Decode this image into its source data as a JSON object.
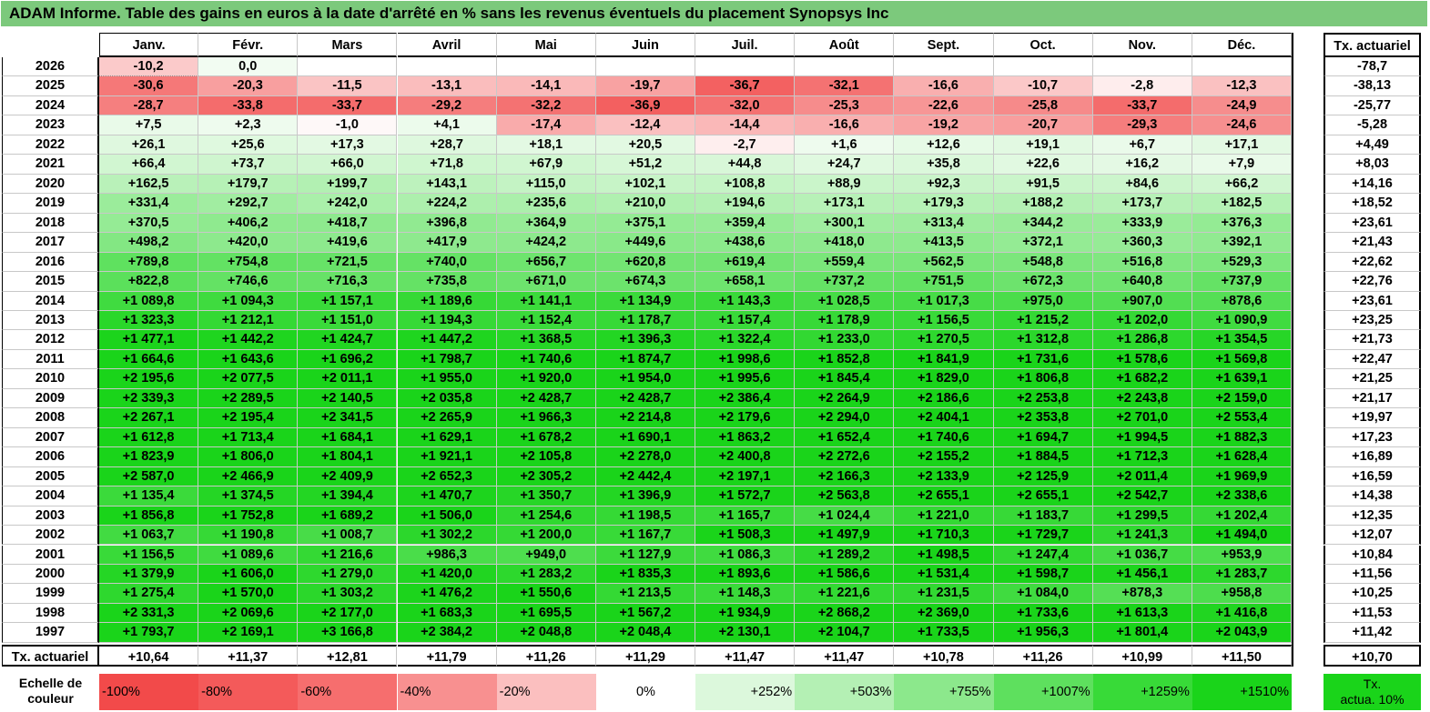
{
  "title": "ADAM Informe. Table des gains en euros à la date d'arrêté en % sans les revenus éventuels du placement Synopsys Inc",
  "chart_data": {
    "type": "heatmap",
    "columns": [
      "Janv.",
      "Févr.",
      "Mars",
      "Avril",
      "Mai",
      "Juin",
      "Juil.",
      "Août",
      "Sept.",
      "Oct.",
      "Nov.",
      "Déc."
    ],
    "summary_column_header": "Tx. actuariel",
    "rows": [
      {
        "year": "2026",
        "values": [
          "-10,2",
          "0,0",
          "",
          "",
          "",
          "",
          "",
          "",
          "",
          "",
          "",
          ""
        ],
        "tx": "-78,7"
      },
      {
        "year": "2025",
        "values": [
          "-30,6",
          "-20,3",
          "-11,5",
          "-13,1",
          "-14,1",
          "-19,7",
          "-36,7",
          "-32,1",
          "-16,6",
          "-10,7",
          "-2,8",
          "-12,3"
        ],
        "tx": "-38,13"
      },
      {
        "year": "2024",
        "values": [
          "-28,7",
          "-33,8",
          "-33,7",
          "-29,2",
          "-32,2",
          "-36,9",
          "-32,0",
          "-25,3",
          "-22,6",
          "-25,8",
          "-33,7",
          "-24,9"
        ],
        "tx": "-25,77"
      },
      {
        "year": "2023",
        "values": [
          "+7,5",
          "+2,3",
          "-1,0",
          "+4,1",
          "-17,4",
          "-12,4",
          "-14,4",
          "-16,6",
          "-19,2",
          "-20,7",
          "-29,3",
          "-24,6"
        ],
        "tx": "-5,28"
      },
      {
        "year": "2022",
        "values": [
          "+26,1",
          "+25,6",
          "+17,3",
          "+28,7",
          "+18,1",
          "+20,5",
          "-2,7",
          "+1,6",
          "+12,6",
          "+19,1",
          "+6,7",
          "+17,1"
        ],
        "tx": "+4,49"
      },
      {
        "year": "2021",
        "values": [
          "+66,4",
          "+73,7",
          "+66,0",
          "+71,8",
          "+67,9",
          "+51,2",
          "+44,8",
          "+24,7",
          "+35,8",
          "+22,6",
          "+16,2",
          "+7,9"
        ],
        "tx": "+8,03"
      },
      {
        "year": "2020",
        "values": [
          "+162,5",
          "+179,7",
          "+199,7",
          "+143,1",
          "+115,0",
          "+102,1",
          "+108,8",
          "+88,9",
          "+92,3",
          "+91,5",
          "+84,6",
          "+66,2"
        ],
        "tx": "+14,16"
      },
      {
        "year": "2019",
        "values": [
          "+331,4",
          "+292,7",
          "+242,0",
          "+224,2",
          "+235,6",
          "+210,0",
          "+194,6",
          "+173,1",
          "+179,3",
          "+188,2",
          "+173,7",
          "+182,5"
        ],
        "tx": "+18,52"
      },
      {
        "year": "2018",
        "values": [
          "+370,5",
          "+406,2",
          "+418,7",
          "+396,8",
          "+364,9",
          "+375,1",
          "+359,4",
          "+300,1",
          "+313,4",
          "+344,2",
          "+333,9",
          "+376,3"
        ],
        "tx": "+23,61"
      },
      {
        "year": "2017",
        "values": [
          "+498,2",
          "+420,0",
          "+419,6",
          "+417,9",
          "+424,2",
          "+449,6",
          "+438,6",
          "+418,0",
          "+413,5",
          "+372,1",
          "+360,3",
          "+392,1"
        ],
        "tx": "+21,43"
      },
      {
        "year": "2016",
        "values": [
          "+789,8",
          "+754,8",
          "+721,5",
          "+740,0",
          "+656,7",
          "+620,8",
          "+619,4",
          "+559,4",
          "+562,5",
          "+548,8",
          "+516,8",
          "+529,3"
        ],
        "tx": "+22,62"
      },
      {
        "year": "2015",
        "values": [
          "+822,8",
          "+746,6",
          "+716,3",
          "+735,8",
          "+671,0",
          "+674,3",
          "+658,1",
          "+737,2",
          "+751,5",
          "+672,3",
          "+640,8",
          "+737,9"
        ],
        "tx": "+22,76"
      },
      {
        "year": "2014",
        "values": [
          "+1 089,8",
          "+1 094,3",
          "+1 157,1",
          "+1 189,6",
          "+1 141,1",
          "+1 134,9",
          "+1 143,3",
          "+1 028,5",
          "+1 017,3",
          "+975,0",
          "+907,0",
          "+878,6"
        ],
        "tx": "+23,61"
      },
      {
        "year": "2013",
        "values": [
          "+1 323,3",
          "+1 212,1",
          "+1 151,0",
          "+1 194,3",
          "+1 152,4",
          "+1 178,7",
          "+1 157,4",
          "+1 178,9",
          "+1 156,5",
          "+1 215,2",
          "+1 202,0",
          "+1 090,9"
        ],
        "tx": "+23,25"
      },
      {
        "year": "2012",
        "values": [
          "+1 477,1",
          "+1 442,2",
          "+1 424,7",
          "+1 447,2",
          "+1 368,5",
          "+1 396,3",
          "+1 322,4",
          "+1 233,0",
          "+1 270,5",
          "+1 312,8",
          "+1 286,8",
          "+1 354,5"
        ],
        "tx": "+21,73"
      },
      {
        "year": "2011",
        "values": [
          "+1 664,6",
          "+1 643,6",
          "+1 696,2",
          "+1 798,7",
          "+1 740,6",
          "+1 874,7",
          "+1 998,6",
          "+1 852,8",
          "+1 841,9",
          "+1 731,6",
          "+1 578,6",
          "+1 569,8"
        ],
        "tx": "+22,47"
      },
      {
        "year": "2010",
        "values": [
          "+2 195,6",
          "+2 077,5",
          "+2 011,1",
          "+1 955,0",
          "+1 920,0",
          "+1 954,0",
          "+1 995,6",
          "+1 845,4",
          "+1 829,0",
          "+1 806,8",
          "+1 682,2",
          "+1 639,1"
        ],
        "tx": "+21,25"
      },
      {
        "year": "2009",
        "values": [
          "+2 339,3",
          "+2 289,5",
          "+2 140,5",
          "+2 035,8",
          "+2 428,7",
          "+2 428,7",
          "+2 386,4",
          "+2 264,9",
          "+2 186,6",
          "+2 253,8",
          "+2 243,8",
          "+2 159,0"
        ],
        "tx": "+21,17"
      },
      {
        "year": "2008",
        "values": [
          "+2 267,1",
          "+2 195,4",
          "+2 341,5",
          "+2 265,9",
          "+1 966,3",
          "+2 214,8",
          "+2 179,6",
          "+2 294,0",
          "+2 404,1",
          "+2 353,8",
          "+2 701,0",
          "+2 553,4"
        ],
        "tx": "+19,97"
      },
      {
        "year": "2007",
        "values": [
          "+1 612,8",
          "+1 713,4",
          "+1 684,1",
          "+1 629,1",
          "+1 678,2",
          "+1 690,1",
          "+1 863,2",
          "+1 652,4",
          "+1 740,6",
          "+1 694,7",
          "+1 994,5",
          "+1 882,3"
        ],
        "tx": "+17,23"
      },
      {
        "year": "2006",
        "values": [
          "+1 823,9",
          "+1 806,0",
          "+1 804,1",
          "+1 921,1",
          "+2 105,8",
          "+2 278,0",
          "+2 400,8",
          "+2 272,6",
          "+2 155,2",
          "+1 884,5",
          "+1 712,3",
          "+1 628,4"
        ],
        "tx": "+16,89"
      },
      {
        "year": "2005",
        "values": [
          "+2 587,0",
          "+2 466,9",
          "+2 409,9",
          "+2 652,3",
          "+2 305,2",
          "+2 442,4",
          "+2 197,1",
          "+2 166,3",
          "+2 133,9",
          "+2 125,9",
          "+2 011,4",
          "+1 969,9"
        ],
        "tx": "+16,59"
      },
      {
        "year": "2004",
        "values": [
          "+1 135,4",
          "+1 374,5",
          "+1 394,4",
          "+1 470,7",
          "+1 350,7",
          "+1 396,9",
          "+1 572,7",
          "+2 563,8",
          "+2 655,1",
          "+2 655,1",
          "+2 542,7",
          "+2 338,6"
        ],
        "tx": "+14,38"
      },
      {
        "year": "2003",
        "values": [
          "+1 856,8",
          "+1 752,8",
          "+1 689,2",
          "+1 506,0",
          "+1 254,6",
          "+1 198,5",
          "+1 165,7",
          "+1 024,4",
          "+1 221,0",
          "+1 183,7",
          "+1 299,5",
          "+1 202,4"
        ],
        "tx": "+12,35"
      },
      {
        "year": "2002",
        "values": [
          "+1 063,7",
          "+1 190,8",
          "+1 008,7",
          "+1 302,2",
          "+1 200,0",
          "+1 167,7",
          "+1 508,3",
          "+1 497,9",
          "+1 710,3",
          "+1 729,7",
          "+1 241,3",
          "+1 494,0"
        ],
        "tx": "+12,07"
      },
      {
        "year": "2001",
        "values": [
          "+1 156,5",
          "+1 089,6",
          "+1 216,6",
          "+986,3",
          "+949,0",
          "+1 127,9",
          "+1 086,3",
          "+1 289,2",
          "+1 498,5",
          "+1 247,4",
          "+1 036,7",
          "+953,9"
        ],
        "tx": "+10,84"
      },
      {
        "year": "2000",
        "values": [
          "+1 379,9",
          "+1 606,0",
          "+1 279,0",
          "+1 420,0",
          "+1 283,2",
          "+1 835,3",
          "+1 893,6",
          "+1 586,6",
          "+1 531,4",
          "+1 598,7",
          "+1 456,1",
          "+1 283,7"
        ],
        "tx": "+11,56"
      },
      {
        "year": "1999",
        "values": [
          "+1 275,4",
          "+1 570,0",
          "+1 303,2",
          "+1 476,2",
          "+1 550,6",
          "+1 213,5",
          "+1 148,3",
          "+1 221,6",
          "+1 231,5",
          "+1 084,0",
          "+878,3",
          "+958,8"
        ],
        "tx": "+10,25"
      },
      {
        "year": "1998",
        "values": [
          "+2 331,3",
          "+2 069,6",
          "+2 177,0",
          "+1 683,3",
          "+1 695,5",
          "+1 567,2",
          "+1 934,9",
          "+2 868,2",
          "+2 369,0",
          "+1 733,6",
          "+1 613,3",
          "+1 416,8"
        ],
        "tx": "+11,53"
      },
      {
        "year": "1997",
        "values": [
          "+1 793,7",
          "+2 169,1",
          "+3 166,8",
          "+2 384,2",
          "+2 048,8",
          "+2 048,4",
          "+2 130,1",
          "+2 104,7",
          "+1 733,5",
          "+1 956,3",
          "+1 801,4",
          "+2 043,9"
        ],
        "tx": "+11,42"
      }
    ],
    "footer_row": {
      "label": "Tx. actuariel",
      "values": [
        "+10,64",
        "+11,37",
        "+12,81",
        "+11,79",
        "+11,26",
        "+11,29",
        "+11,47",
        "+11,47",
        "+10,78",
        "+11,26",
        "+10,99",
        "+11,50"
      ],
      "tx": "+10,70"
    },
    "color_scale": {
      "label_line1": "Echelle de",
      "label_line2": "couleur",
      "steps": [
        {
          "text": "-100%",
          "color": "#f24a4a",
          "align": "left"
        },
        {
          "text": "-80%",
          "color": "#f45a5a",
          "align": "left"
        },
        {
          "text": "-60%",
          "color": "#f66e6e",
          "align": "left"
        },
        {
          "text": "-40%",
          "color": "#f89090",
          "align": "left"
        },
        {
          "text": "-20%",
          "color": "#fbbfbf",
          "align": "left"
        },
        {
          "text": "0%",
          "color": "#ffffff",
          "align": "center"
        },
        {
          "text": "+252%",
          "color": "#dcf8dc",
          "align": "right"
        },
        {
          "text": "+503%",
          "color": "#b4f0b4",
          "align": "right"
        },
        {
          "text": "+755%",
          "color": "#8ce88c",
          "align": "right"
        },
        {
          "text": "+1007%",
          "color": "#5ee05e",
          "align": "right"
        },
        {
          "text": "+1259%",
          "color": "#38da38",
          "align": "right"
        },
        {
          "text": "+1510%",
          "color": "#1ad41a",
          "align": "right"
        }
      ],
      "tx_legend_line1": "Tx.",
      "tx_legend_line2": "actua. 10%",
      "tx_legend_color": "#1ad41a"
    },
    "colors": {
      "title_bg": "#7cc97c",
      "negative_max": "#f24a4a",
      "positive_max": "#1ad41a"
    }
  }
}
